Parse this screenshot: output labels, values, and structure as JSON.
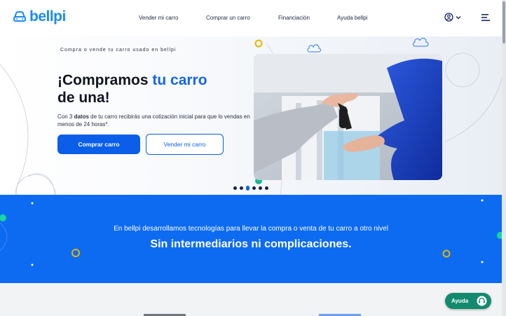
{
  "brand": {
    "name": "bellpi",
    "color": "#1a8cf0"
  },
  "nav": {
    "items": [
      {
        "label": "Vender mi carro"
      },
      {
        "label": "Comprar un carro"
      },
      {
        "label": "Financiación"
      },
      {
        "label": "Ayuda bellpi"
      }
    ],
    "user_icon": "user-circle-icon",
    "menu_icon": "hamburger-icon"
  },
  "hero": {
    "eyebrow": "Compra o vende tu carro usado en bellpi",
    "title_part1": "¡Compramos ",
    "title_accent": "tu carro",
    "title_part2": "de una!",
    "desc_pre": "Con 3 ",
    "desc_bold": "datos",
    "desc_post": " de tu carro recibirás una cotización inicial para que lo vendas en menos de 24 horas*.",
    "primary_button": "Comprar carro",
    "secondary_button": "Vender mi carro",
    "carousel": {
      "count": 6,
      "active_index": 2
    }
  },
  "band": {
    "subtitle": "En bellpi desarrollamos tecnologías para llevar la compra o venta de tu carro a otro nivel",
    "title": "Sin intermediarios ni complicaciones."
  },
  "help": {
    "label": "Ayuda",
    "icon": "headset-icon"
  },
  "colors": {
    "primary": "#0a5ee8",
    "band": "#0d6bf2",
    "help": "#138a6e",
    "accent_text": "#1466e6"
  }
}
